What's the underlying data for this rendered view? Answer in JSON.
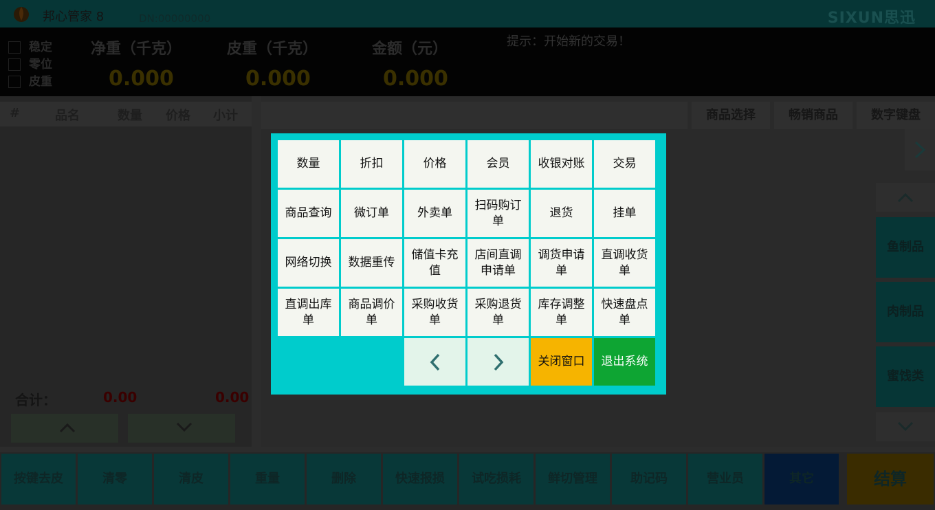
{
  "title_bar": {
    "app_title": "邦心管家 8",
    "dn": "DN:00000000",
    "brand": "SIXUN思迅"
  },
  "scale": {
    "statuses": [
      "稳定",
      "零位",
      "皮重"
    ],
    "net_weight_label": "净重（千克）",
    "net_weight_value": "0.000",
    "tare_label": "皮重（千克）",
    "tare_value": "0.000",
    "amount_label": "金额（元）",
    "amount_value": "0.000",
    "hint": "提示：开始新的交易！"
  },
  "cart": {
    "columns": [
      "#",
      "品名",
      "数量",
      "价格",
      "小计"
    ],
    "total_label": "合计：",
    "total_qty": "0.00",
    "total_amount": "0.00"
  },
  "product_tabs": [
    "商品选择",
    "畅销商品",
    "数字键盘"
  ],
  "categories": [
    "鱼制品",
    "肉制品",
    "蜜饯类"
  ],
  "bottom_buttons": [
    "按键去皮",
    "清零",
    "清皮",
    "重量",
    "删除",
    "快速报损",
    "试吃损耗",
    "鲜切管理",
    "助记码",
    "营业员",
    "其它",
    "结算"
  ],
  "menu": {
    "rows": [
      [
        "数量",
        "折扣",
        "价格",
        "会员",
        "收银对账",
        "交易"
      ],
      [
        "商品查询",
        "微订单",
        "外卖单",
        "扫码购订单",
        "退货",
        "挂单"
      ],
      [
        "网络切换",
        "数据重传",
        "储值卡充值",
        "店间直调申请单",
        "调货申请单",
        "直调收货单"
      ],
      [
        "直调出库单",
        "商品调价单",
        "采购收货单",
        "采购退货单",
        "库存调整单",
        "快速盘点单"
      ]
    ],
    "close_label": "关闭窗口",
    "exit_label": "退出系统"
  },
  "colors": {
    "modal_bg": "#00cccc",
    "close_button": "#f6b400",
    "exit_button": "#0ea533",
    "button_face": "#f4f6f0"
  }
}
